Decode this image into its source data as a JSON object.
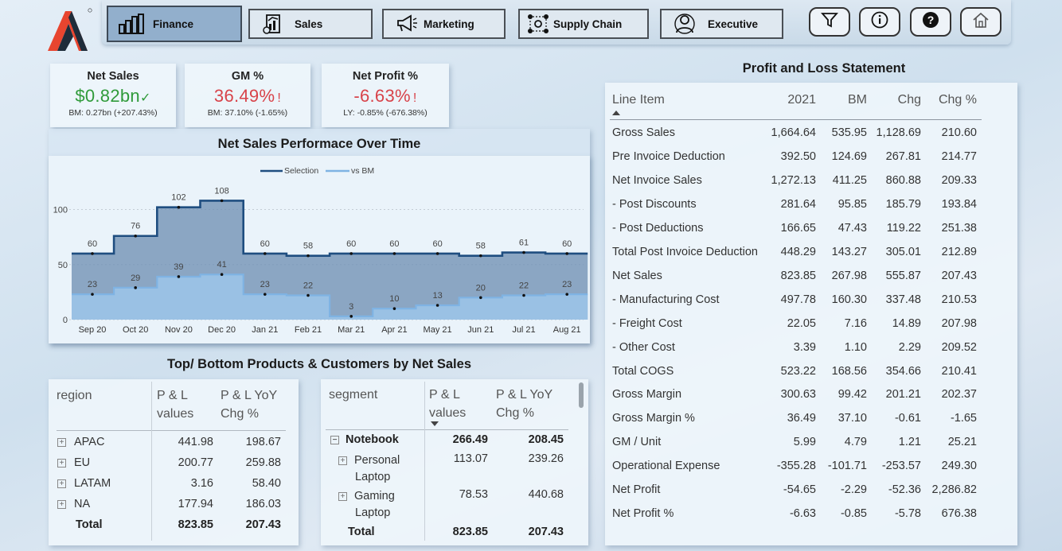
{
  "nav": {
    "tabs": [
      {
        "label": "Finance",
        "icon": "bar-chart-icon",
        "active": true
      },
      {
        "label": "Sales",
        "icon": "sales-report-icon"
      },
      {
        "label": "Marketing",
        "icon": "megaphone-icon"
      },
      {
        "label": "Supply Chain",
        "icon": "supply-chain-icon"
      },
      {
        "label": "Executive",
        "icon": "executive-icon"
      }
    ],
    "actions": [
      "filter-icon",
      "info-icon",
      "help-icon",
      "home-icon"
    ]
  },
  "kpis": [
    {
      "title": "Net Sales",
      "value": "$0.82bn",
      "status_mark": "✓",
      "sub": "BM: 0.27bn (+207.43%)",
      "color": "#2f9a3a"
    },
    {
      "title": "GM %",
      "value": "36.49%",
      "status_mark": "!",
      "sub": "BM: 37.10% (-1.65%)",
      "color": "#d8434a"
    },
    {
      "title": "Net Profit %",
      "value": "-6.63%",
      "status_mark": "!",
      "sub": "LY: -0.85% (-676.38%)",
      "color": "#d8434a"
    }
  ],
  "net_sales_chart": {
    "title": "Net Sales Performace Over Time"
  },
  "chart_data": {
    "type": "area",
    "categories": [
      "Sep 20",
      "Oct 20",
      "Nov 20",
      "Dec 20",
      "Jan 21",
      "Feb 21",
      "Mar 21",
      "Apr 21",
      "May 21",
      "Jun 21",
      "Jul 21",
      "Aug 21"
    ],
    "series": [
      {
        "name": "Selection",
        "values": [
          60,
          76,
          102,
          108,
          60,
          58,
          60,
          60,
          60,
          58,
          61,
          60
        ],
        "color": "#1f4e80"
      },
      {
        "name": "vs BM",
        "values": [
          23,
          29,
          39,
          41,
          23,
          22,
          3,
          10,
          13,
          20,
          22,
          23
        ],
        "color": "#7fb3e3"
      }
    ],
    "ylim": [
      0,
      120
    ],
    "yticks": [
      0,
      50,
      100
    ],
    "legend": "top-center",
    "step": true
  },
  "region_table": {
    "title": "Top/ Bottom Products & Customers by Net Sales",
    "headers": [
      "region",
      "P & L values",
      "P & L YoY Chg %"
    ],
    "rows": [
      {
        "name": "APAC",
        "v": "441.98",
        "c": "198.67"
      },
      {
        "name": "EU",
        "v": "200.77",
        "c": "259.88"
      },
      {
        "name": "LATAM",
        "v": "3.16",
        "c": "58.40"
      },
      {
        "name": "NA",
        "v": "177.94",
        "c": "186.03"
      }
    ],
    "total": {
      "name": "Total",
      "v": "823.85",
      "c": "207.43"
    }
  },
  "segment_table": {
    "headers": [
      "segment",
      "P & L values",
      "P & L YoY Chg %"
    ],
    "group": {
      "name": "Notebook",
      "v": "266.49",
      "c": "208.45"
    },
    "rows": [
      {
        "name1": "Personal",
        "name2": "Laptop",
        "v": "113.07",
        "c": "239.26"
      },
      {
        "name1": "Gaming",
        "name2": "Laptop",
        "v": "78.53",
        "c": "440.68"
      }
    ],
    "total": {
      "name": "Total",
      "v": "823.85",
      "c": "207.43"
    }
  },
  "pl": {
    "title": "Profit and Loss Statement",
    "headers": [
      "Line Item",
      "2021",
      "BM",
      "Chg",
      "Chg %"
    ],
    "rows": [
      [
        "Gross Sales",
        "1,664.64",
        "535.95",
        "1,128.69",
        "210.60"
      ],
      [
        "Pre Invoice Deduction",
        "392.50",
        "124.69",
        "267.81",
        "214.77"
      ],
      [
        "Net Invoice Sales",
        "1,272.13",
        "411.25",
        "860.88",
        "209.33"
      ],
      [
        "- Post Discounts",
        "281.64",
        "95.85",
        "185.79",
        "193.84"
      ],
      [
        "- Post Deductions",
        "166.65",
        "47.43",
        "119.22",
        "251.38"
      ],
      [
        "Total Post Invoice Deduction",
        "448.29",
        "143.27",
        "305.01",
        "212.89"
      ],
      [
        "Net Sales",
        "823.85",
        "267.98",
        "555.87",
        "207.43"
      ],
      [
        "- Manufacturing Cost",
        "497.78",
        "160.30",
        "337.48",
        "210.53"
      ],
      [
        "- Freight Cost",
        "22.05",
        "7.16",
        "14.89",
        "207.98"
      ],
      [
        "- Other Cost",
        "3.39",
        "1.10",
        "2.29",
        "209.52"
      ],
      [
        "Total COGS",
        "523.22",
        "168.56",
        "354.66",
        "210.41"
      ],
      [
        "Gross Margin",
        "300.63",
        "99.42",
        "201.21",
        "202.37"
      ],
      [
        "Gross Margin %",
        "36.49",
        "37.10",
        "-0.61",
        "-1.65"
      ],
      [
        "GM / Unit",
        "5.99",
        "4.79",
        "1.21",
        "25.21"
      ],
      [
        "Operational Expense",
        "-355.28",
        "-101.71",
        "-253.57",
        "249.30"
      ],
      [
        "Net Profit",
        "-54.65",
        "-2.29",
        "-52.36",
        "2,286.82"
      ],
      [
        "Net Profit %",
        "-6.63",
        "-0.85",
        "-5.78",
        "676.38"
      ]
    ]
  }
}
